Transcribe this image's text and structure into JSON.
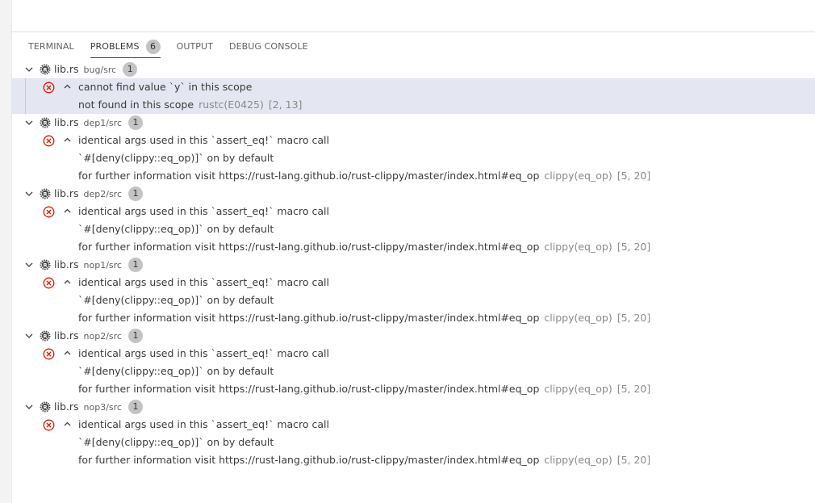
{
  "tabs": [
    {
      "label": "TERMINAL",
      "active": false
    },
    {
      "label": "PROBLEMS",
      "active": true,
      "count": "6"
    },
    {
      "label": "OUTPUT",
      "active": false
    },
    {
      "label": "DEBUG CONSOLE",
      "active": false
    }
  ],
  "groups": [
    {
      "file": "lib.rs",
      "path": "bug/src",
      "count": "1",
      "message": "cannot find value `y` in this scope",
      "details": [
        {
          "text": "not found in this scope",
          "source": "rustc(E0425)",
          "location": "[2, 13]"
        }
      ]
    },
    {
      "file": "lib.rs",
      "path": "dep1/src",
      "count": "1",
      "message": "identical args used in this `assert_eq!` macro call",
      "details": [
        {
          "text": "`#[deny(clippy::eq_op)]` on by default",
          "source": "",
          "location": ""
        },
        {
          "text": "for further information visit https://rust-lang.github.io/rust-clippy/master/index.html#eq_op",
          "source": "clippy(eq_op)",
          "location": "[5, 20]"
        }
      ]
    },
    {
      "file": "lib.rs",
      "path": "dep2/src",
      "count": "1",
      "message": "identical args used in this `assert_eq!` macro call",
      "details": [
        {
          "text": "`#[deny(clippy::eq_op)]` on by default",
          "source": "",
          "location": ""
        },
        {
          "text": "for further information visit https://rust-lang.github.io/rust-clippy/master/index.html#eq_op",
          "source": "clippy(eq_op)",
          "location": "[5, 20]"
        }
      ]
    },
    {
      "file": "lib.rs",
      "path": "nop1/src",
      "count": "1",
      "message": "identical args used in this `assert_eq!` macro call",
      "details": [
        {
          "text": "`#[deny(clippy::eq_op)]` on by default",
          "source": "",
          "location": ""
        },
        {
          "text": "for further information visit https://rust-lang.github.io/rust-clippy/master/index.html#eq_op",
          "source": "clippy(eq_op)",
          "location": "[5, 20]"
        }
      ]
    },
    {
      "file": "lib.rs",
      "path": "nop2/src",
      "count": "1",
      "message": "identical args used in this `assert_eq!` macro call",
      "details": [
        {
          "text": "`#[deny(clippy::eq_op)]` on by default",
          "source": "",
          "location": ""
        },
        {
          "text": "for further information visit https://rust-lang.github.io/rust-clippy/master/index.html#eq_op",
          "source": "clippy(eq_op)",
          "location": "[5, 20]"
        }
      ]
    },
    {
      "file": "lib.rs",
      "path": "nop3/src",
      "count": "1",
      "message": "identical args used in this `assert_eq!` macro call",
      "details": [
        {
          "text": "`#[deny(clippy::eq_op)]` on by default",
          "source": "",
          "location": ""
        },
        {
          "text": "for further information visit https://rust-lang.github.io/rust-clippy/master/index.html#eq_op",
          "source": "clippy(eq_op)",
          "location": "[5, 20]"
        }
      ]
    }
  ],
  "icons": {
    "expand": "chevron-down-icon",
    "file": "rust-file-icon",
    "error": "error-circle-icon",
    "collapse": "chevron-up-icon"
  },
  "colors": {
    "error": "#e51400",
    "selection": "#e4e6f1",
    "badge": "#c4c4c4",
    "active_tab_underline": "#424242"
  }
}
